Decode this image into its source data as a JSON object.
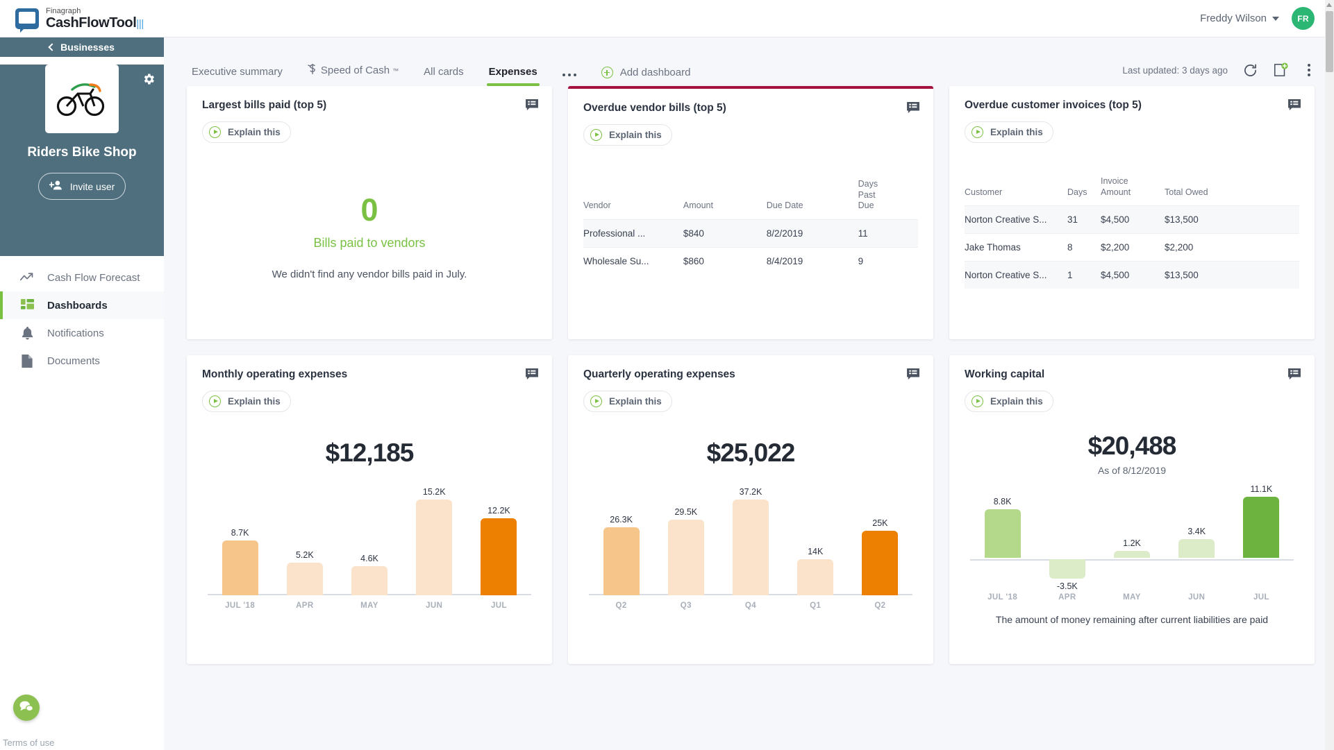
{
  "brand": {
    "sub": "Finagraph",
    "name": "CashFlowTool",
    "tm": "™"
  },
  "topbar": {
    "user_name": "Freddy Wilson",
    "avatar_initials": "FR"
  },
  "sidebar": {
    "back_label": "Businesses",
    "business_name": "Riders Bike Shop",
    "invite_label": "Invite user",
    "items": [
      {
        "label": "Cash Flow Forecast",
        "icon": "trend-up-icon",
        "active": false
      },
      {
        "label": "Dashboards",
        "icon": "dashboard-grid-icon",
        "active": true
      },
      {
        "label": "Notifications",
        "icon": "bell-icon",
        "active": false
      },
      {
        "label": "Documents",
        "icon": "document-icon",
        "active": false
      }
    ],
    "terms_label": "Terms of use"
  },
  "tabs": [
    {
      "label": "Executive summary",
      "active": false
    },
    {
      "label": "Speed of Cash",
      "sup": "™",
      "icon": "dollar-speed-icon",
      "active": false
    },
    {
      "label": "All cards",
      "active": false
    },
    {
      "label": "Expenses",
      "active": true
    }
  ],
  "toolbar": {
    "more_tabs": "•••",
    "add_dashboard_label": "Add dashboard",
    "last_updated": "Last updated: 3 days ago",
    "refresh_icon": "refresh-icon",
    "new_card_icon": "add-card-icon",
    "kebab_icon": "more-vertical-icon"
  },
  "explain_label": "Explain this",
  "cards": {
    "largest_bills": {
      "title": "Largest bills paid (top 5)",
      "empty_number": "0",
      "empty_label": "Bills paid to vendors",
      "empty_message": "We didn't find any vendor bills paid in July."
    },
    "overdue_vendor_bills": {
      "title": "Overdue vendor bills (top 5)",
      "accent_color": "#a5123f",
      "columns": [
        "Vendor",
        "Amount",
        "Due Date",
        "Days Past Due"
      ],
      "rows": [
        [
          "Professional ...",
          "$840",
          "8/2/2019",
          "11"
        ],
        [
          "Wholesale Su...",
          "$860",
          "8/4/2019",
          "9"
        ]
      ]
    },
    "overdue_customer_invoices": {
      "title": "Overdue customer invoices (top 5)",
      "columns": [
        "Customer",
        "Days",
        "Invoice Amount",
        "Total Owed"
      ],
      "rows": [
        [
          "Norton Creative S...",
          "31",
          "$4,500",
          "$13,500"
        ],
        [
          "Jake Thomas",
          "8",
          "$2,200",
          "$2,200"
        ],
        [
          "Norton Creative S...",
          "1",
          "$4,500",
          "$13,500"
        ]
      ]
    },
    "monthly_operating_expenses": {
      "title": "Monthly operating expenses",
      "headline": "$12,185"
    },
    "quarterly_operating_expenses": {
      "title": "Quarterly operating expenses",
      "headline": "$25,022"
    },
    "working_capital": {
      "title": "Working capital",
      "headline": "$20,488",
      "as_of": "As of 8/12/2019",
      "footnote": "The amount of money remaining after current liabilities are paid"
    }
  },
  "chart_data": [
    {
      "type": "bar",
      "title": "Monthly operating expenses",
      "headline_value": 12185,
      "categories": [
        "JUL '18",
        "APR",
        "MAY",
        "JUN",
        "JUL"
      ],
      "values": [
        8700,
        5200,
        4600,
        15200,
        12200
      ],
      "labels": [
        "8.7K",
        "5.2K",
        "4.6K",
        "15.2K",
        "12.2K"
      ],
      "colors": [
        "#f5c58a",
        "#fbe3cb",
        "#fbe3cb",
        "#fbe3cb",
        "#ed8000"
      ],
      "xlabel": "",
      "ylabel": "",
      "ylim": [
        0,
        15200
      ],
      "grid": false,
      "legend": "none"
    },
    {
      "type": "bar",
      "title": "Quarterly operating expenses",
      "headline_value": 25022,
      "categories": [
        "Q2",
        "Q3",
        "Q4",
        "Q1",
        "Q2"
      ],
      "values": [
        26300,
        29500,
        37200,
        14000,
        25000
      ],
      "labels": [
        "26.3K",
        "29.5K",
        "37.2K",
        "14K",
        "25K"
      ],
      "colors": [
        "#f5c58a",
        "#fbe3cb",
        "#fbe3cb",
        "#fbe3cb",
        "#ed8000"
      ],
      "xlabel": "",
      "ylabel": "",
      "ylim": [
        0,
        37200
      ],
      "grid": false,
      "legend": "none"
    },
    {
      "type": "bar",
      "title": "Working capital",
      "headline_value": 20488,
      "categories": [
        "JUL '18",
        "APR",
        "MAY",
        "JUN",
        "JUL"
      ],
      "values": [
        8800,
        -3500,
        1200,
        3400,
        11100
      ],
      "labels": [
        "8.8K",
        "-3.5K",
        "1.2K",
        "3.4K",
        "11.1K"
      ],
      "colors": [
        "#b4d98a",
        "#dcecc8",
        "#dcecc8",
        "#dcecc8",
        "#6cb33f"
      ],
      "xlabel": "",
      "ylabel": "",
      "ylim": [
        -3500,
        11100
      ],
      "grid": false,
      "legend": "none"
    }
  ]
}
